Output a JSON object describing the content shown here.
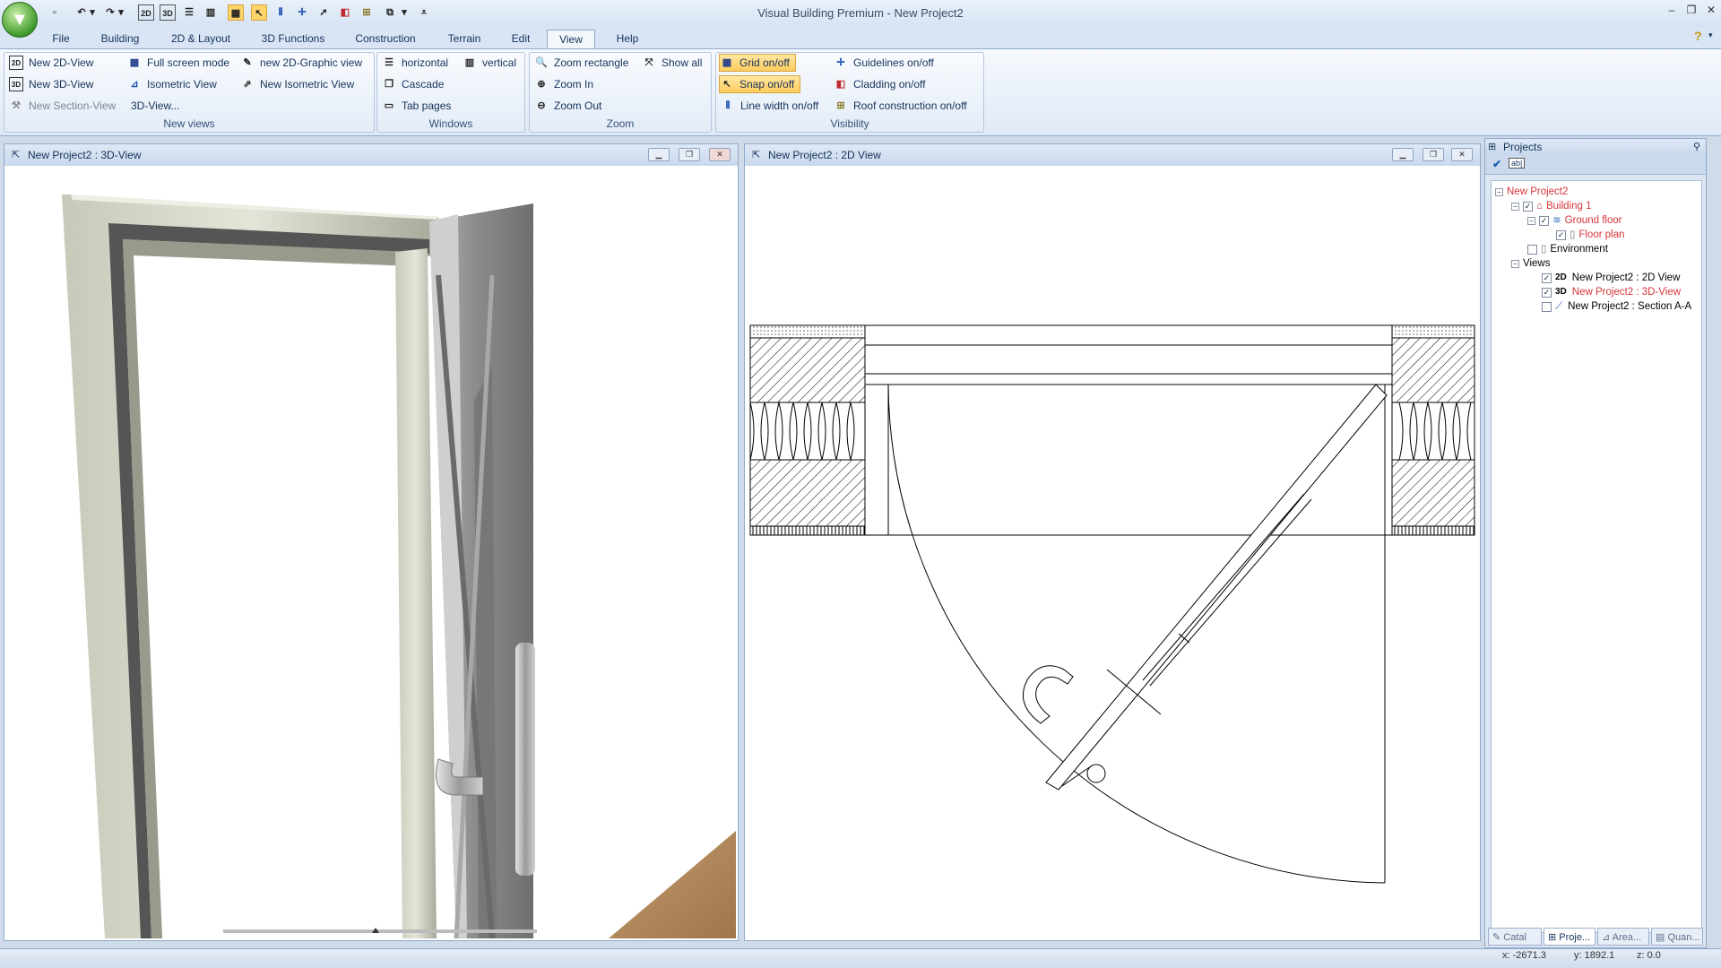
{
  "app": {
    "title": "Visual Building Premium - New Project2"
  },
  "menu": {
    "tabs": [
      "File",
      "Building",
      "2D & Layout",
      "3D Functions",
      "Construction",
      "Terrain",
      "Edit",
      "View",
      "Help"
    ],
    "active": "View"
  },
  "ribbon": {
    "new_views": {
      "label": "New views",
      "new_2d_view": "New 2D-View",
      "new_3d_view": "New 3D-View",
      "new_section_view": "New Section-View",
      "full_screen_mode": "Full screen mode",
      "isometric_view": "Isometric View",
      "view_3d": "3D-View...",
      "new_2d_graphic_view": "new 2D-Graphic view",
      "new_isometric_view": "New Isometric View"
    },
    "windows": {
      "label": "Windows",
      "horizontal": "horizontal",
      "vertical": "vertical",
      "cascade": "Cascade",
      "tab_pages": "Tab pages"
    },
    "zoom": {
      "label": "Zoom",
      "zoom_rectangle": "Zoom rectangle",
      "show_all": "Show all",
      "zoom_in": "Zoom In",
      "zoom_out": "Zoom Out"
    },
    "visibility": {
      "label": "Visibility",
      "grid": "Grid on/off",
      "snap": "Snap on/off",
      "line_width": "Line width on/off",
      "guidelines": "Guidelines on/off",
      "cladding": "Cladding on/off",
      "roof_construction": "Roof construction on/off"
    }
  },
  "views": {
    "view3d_title": "New Project2 : 3D-View",
    "view2d_title": "New Project2 : 2D View"
  },
  "projects_panel": {
    "title": "Projects",
    "tree": {
      "project": "New Project2",
      "building": "Building 1",
      "floor": "Ground floor",
      "floor_plan": "Floor plan",
      "environment": "Environment",
      "views": "Views",
      "view_2d_tag": "2D",
      "view_2d": "New Project2 : 2D View",
      "view_3d_tag": "3D",
      "view_3d": "New Project2 : 3D-View",
      "view_section": "New Project2 : Section A-A"
    },
    "tabs": [
      "Catal",
      "Proje...",
      "Area...",
      "Quan..."
    ]
  },
  "status": {
    "x": "x: -2671.3",
    "y": "y: 1892.1",
    "z": "z: 0.0"
  },
  "colors": {
    "accent_active": "#ffcc5c",
    "chrome": "#d9e5f4",
    "selected_tree": "#d8343a"
  }
}
